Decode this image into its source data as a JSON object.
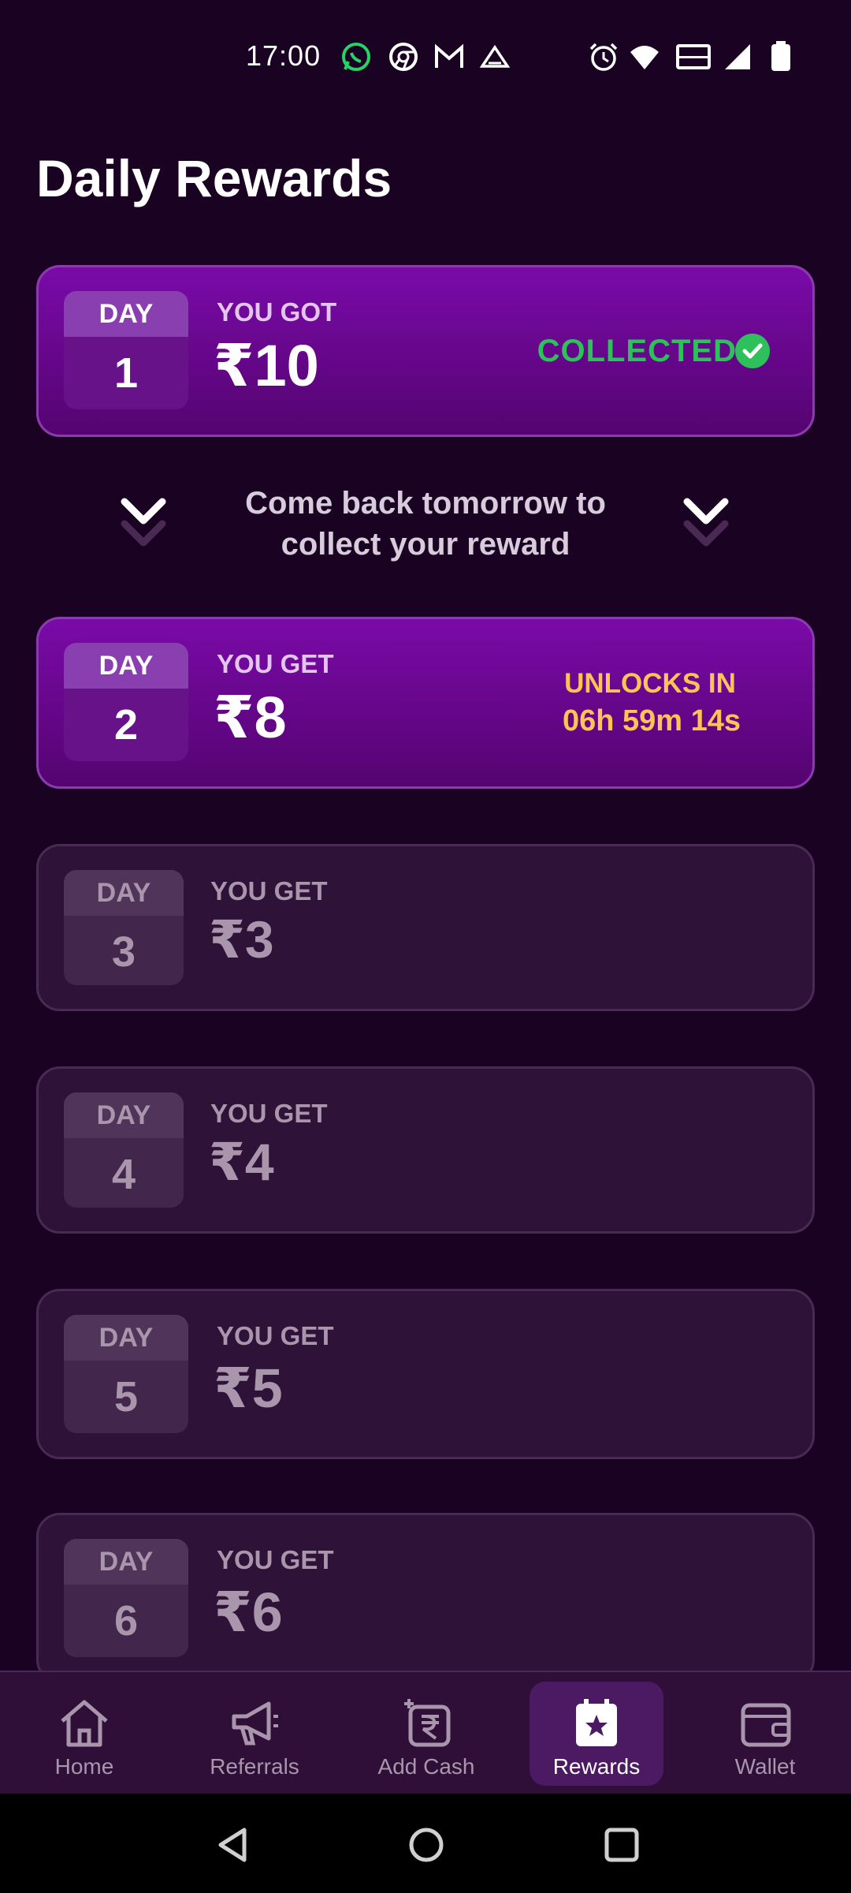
{
  "status_bar": {
    "time": "17:00",
    "left_icons": [
      "whatsapp-icon",
      "chrome-icon",
      "gmail-icon",
      "app-notification-icon"
    ],
    "right_icons": [
      "alarm-icon",
      "wifi-icon",
      "vowifi-icon",
      "signal-icon",
      "battery-icon"
    ]
  },
  "page": {
    "title": "Daily Rewards"
  },
  "rewards": [
    {
      "day_label": "DAY",
      "day": "1",
      "you_label": "YOU GOT",
      "amount": "₹10",
      "status": "COLLECTED"
    },
    {
      "day_label": "DAY",
      "day": "2",
      "you_label": "YOU GET",
      "amount": "₹8",
      "unlock_label": "UNLOCKS IN",
      "unlock_timer": "06h 59m 14s"
    },
    {
      "day_label": "DAY",
      "day": "3",
      "you_label": "YOU GET",
      "amount": "₹3"
    },
    {
      "day_label": "DAY",
      "day": "4",
      "you_label": "YOU GET",
      "amount": "₹4"
    },
    {
      "day_label": "DAY",
      "day": "5",
      "you_label": "YOU GET",
      "amount": "₹5"
    },
    {
      "day_label": "DAY",
      "day": "6",
      "you_label": "YOU GET",
      "amount": "₹6"
    }
  ],
  "comeback": {
    "line1": "Come back tomorrow to",
    "line2": "collect your reward"
  },
  "bottom_nav": [
    {
      "label": "Home",
      "icon": "home-icon"
    },
    {
      "label": "Referrals",
      "icon": "megaphone-icon"
    },
    {
      "label": "Add Cash",
      "icon": "add-cash-icon"
    },
    {
      "label": "Rewards",
      "icon": "rewards-star-icon",
      "active": true
    },
    {
      "label": "Wallet",
      "icon": "wallet-icon"
    }
  ],
  "colors": {
    "background": "#1a0322",
    "active_card": "#7a0aa8",
    "locked_card": "#2f1238",
    "collected_green": "#2ec05a",
    "unlock_amber": "#ffc257"
  }
}
